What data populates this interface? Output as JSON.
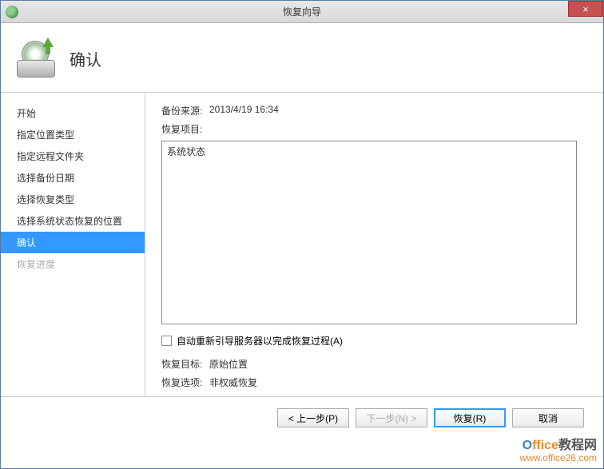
{
  "titlebar": {
    "title": "恢复向导",
    "close": "×"
  },
  "header": {
    "title": "确认"
  },
  "sidebar": {
    "items": [
      {
        "label": "开始"
      },
      {
        "label": "指定位置类型"
      },
      {
        "label": "指定远程文件夹"
      },
      {
        "label": "选择备份日期"
      },
      {
        "label": "选择恢复类型"
      },
      {
        "label": "选择系统状态恢复的位置"
      },
      {
        "label": "确认"
      },
      {
        "label": "恢复进度"
      }
    ]
  },
  "content": {
    "backup_source_label": "备份来源:",
    "backup_source_value": "2013/4/19 16:34",
    "restore_items_label": "恢复项目:",
    "listbox_value": "系统状态",
    "checkbox_label": "自动重新引导服务器以完成恢复过程(A)",
    "restore_target_label": "恢复目标:",
    "restore_target_value": "原始位置",
    "restore_option_label": "恢复选项:",
    "restore_option_value": "非权威恢复"
  },
  "footer": {
    "back": "< 上一步(P)",
    "next": "下一步(N) >",
    "restore": "恢复(R)",
    "cancel": "取消"
  },
  "watermark": {
    "line1_b": "O",
    "line1_o": "ffice",
    "line1_r": "教程网",
    "line2": "www.office26.com"
  }
}
